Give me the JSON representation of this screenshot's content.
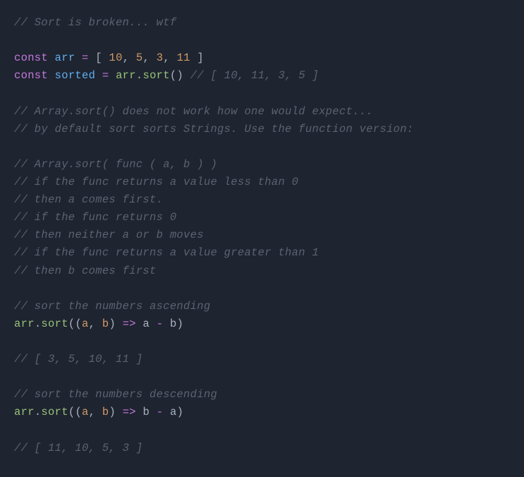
{
  "code": {
    "c_header": "// Sort is broken... wtf",
    "kw_const1": "const",
    "def_arr": "arr",
    "op_eq": "=",
    "brk_open": "[",
    "n10": "10",
    "comma": ",",
    "n5": "5",
    "n3": "3",
    "n11": "11",
    "brk_close": "]",
    "kw_const2": "const",
    "def_sorted": "sorted",
    "id_arr": "arr",
    "dot": ".",
    "m_sort": "sort",
    "paren_open": "(",
    "paren_close": ")",
    "c_result1": "// [ 10, 11, 3, 5 ]",
    "c_exp1": "// Array.sort() does not work how one would expect...",
    "c_exp2": "// by default sort sorts Strings. Use the function version:",
    "c_sig": "// Array.sort( func ( a, b ) )",
    "c_r1": "// if the func returns a value less than 0",
    "c_r2": "// then a comes first.",
    "c_r3": "// if the func returns 0",
    "c_r4": "// then neither a or b moves",
    "c_r5": "// if the func returns a value greater than 1",
    "c_r6": "// then b comes first",
    "c_asc": "// sort the numbers ascending",
    "p_a": "a",
    "p_b": "b",
    "arrow": "=>",
    "minus": "-",
    "c_asc_out": "// [ 3, 5, 10, 11 ]",
    "c_desc": "// sort the numbers descending",
    "c_desc_out": "// [ 11, 10, 5, 3 ]"
  }
}
